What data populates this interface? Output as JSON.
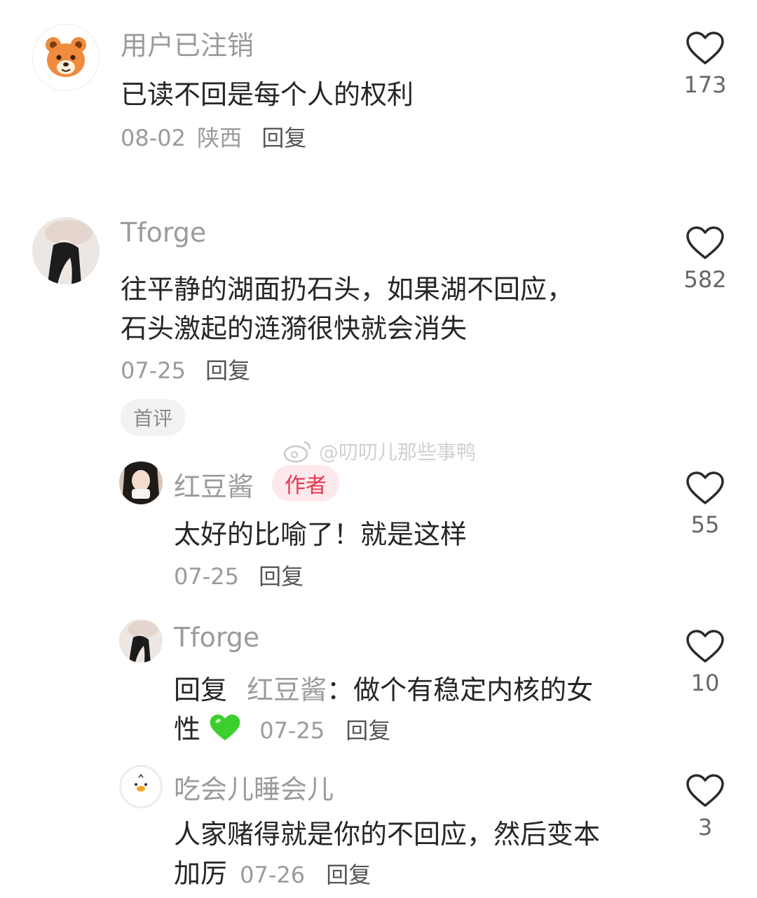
{
  "comments": [
    {
      "user": "用户已注销",
      "text": "已读不回是每个人的权利",
      "date": "08-02",
      "location": "陕西",
      "reply_label": "回复",
      "likes": "173"
    },
    {
      "user": "Tforge",
      "text_line1": "往平静的湖面扔石头，如果湖不回应，",
      "text_line2": "石头激起的涟漪很快就会消失",
      "date": "07-25",
      "reply_label": "回复",
      "likes": "582",
      "badge": "首评"
    }
  ],
  "replies": [
    {
      "user": "红豆酱",
      "badge": "作者",
      "text": "太好的比喻了！就是这样",
      "date": "07-25",
      "reply_label": "回复",
      "likes": "55"
    },
    {
      "user": "Tforge",
      "reply_prefix": "回复",
      "reply_to": "红豆酱",
      "colon": "：",
      "text_line1": "做个有稳定内核的女",
      "text_line2": "性",
      "date": "07-25",
      "reply_label": "回复",
      "likes": "10"
    },
    {
      "user": "吃会儿睡会儿",
      "text_line1": "人家赌得就是你的不回应，然后变本",
      "text_line2": "加厉",
      "date": "07-26",
      "reply_label": "回复",
      "likes": "3"
    }
  ],
  "watermark": "@叨叨儿那些事鸭",
  "icons": {
    "like": "heart-outline-icon",
    "emoji": "green-heart-icon",
    "watermark_logo": "weibo-logo-icon"
  },
  "colors": {
    "author_badge_bg": "#fde8ec",
    "author_badge_text": "#e4394f",
    "green_heart": "#3ccf2e"
  }
}
